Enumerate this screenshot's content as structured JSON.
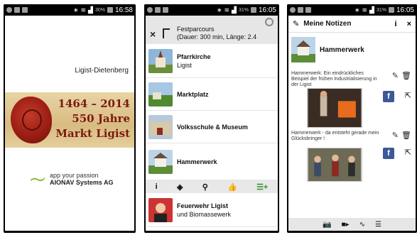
{
  "phone1": {
    "status": {
      "time": "16:58",
      "battery": "30%"
    },
    "city": "Ligist-Dietenberg",
    "banner": {
      "line1": "1464 – 2014",
      "line2": "550 Jahre",
      "line3": "Markt Ligist"
    },
    "promo": {
      "line1": "app your passion",
      "line2": "AIONAV Systems AG"
    }
  },
  "phone2": {
    "status": {
      "time": "16:05",
      "battery": "31%"
    },
    "route_title_line1": "Festparcours",
    "route_title_line2": "(Dauer: 300 min, Länge: 2.4",
    "items": [
      {
        "name": "Pfarrkirche",
        "sub": "Ligist"
      },
      {
        "name": "Marktplatz",
        "sub": ""
      },
      {
        "name": "Volksschule & Museum",
        "sub": ""
      },
      {
        "name": "Hammerwerk",
        "sub": ""
      },
      {
        "name": "Feuerwehr Ligist",
        "sub": "und Biomassewerk"
      }
    ],
    "toolbar": {
      "info": "i",
      "route": "◈",
      "pin": "⚲",
      "like": "👍",
      "add": "☰+"
    }
  },
  "phone3": {
    "status": {
      "time": "16:05",
      "battery": "31%"
    },
    "header_title": "Meine Notizen",
    "info_label": "i",
    "close_label": "×",
    "place_name": "Hammerwerk",
    "notes": [
      {
        "text": "Hammerwerk: Ein eindrückliches Beispiel der frühen Industrialisierung in der Ligist"
      },
      {
        "text": "Hammerwerk - da entsteht gerade mein Glücksbringer !"
      }
    ],
    "fb_label": "f"
  }
}
